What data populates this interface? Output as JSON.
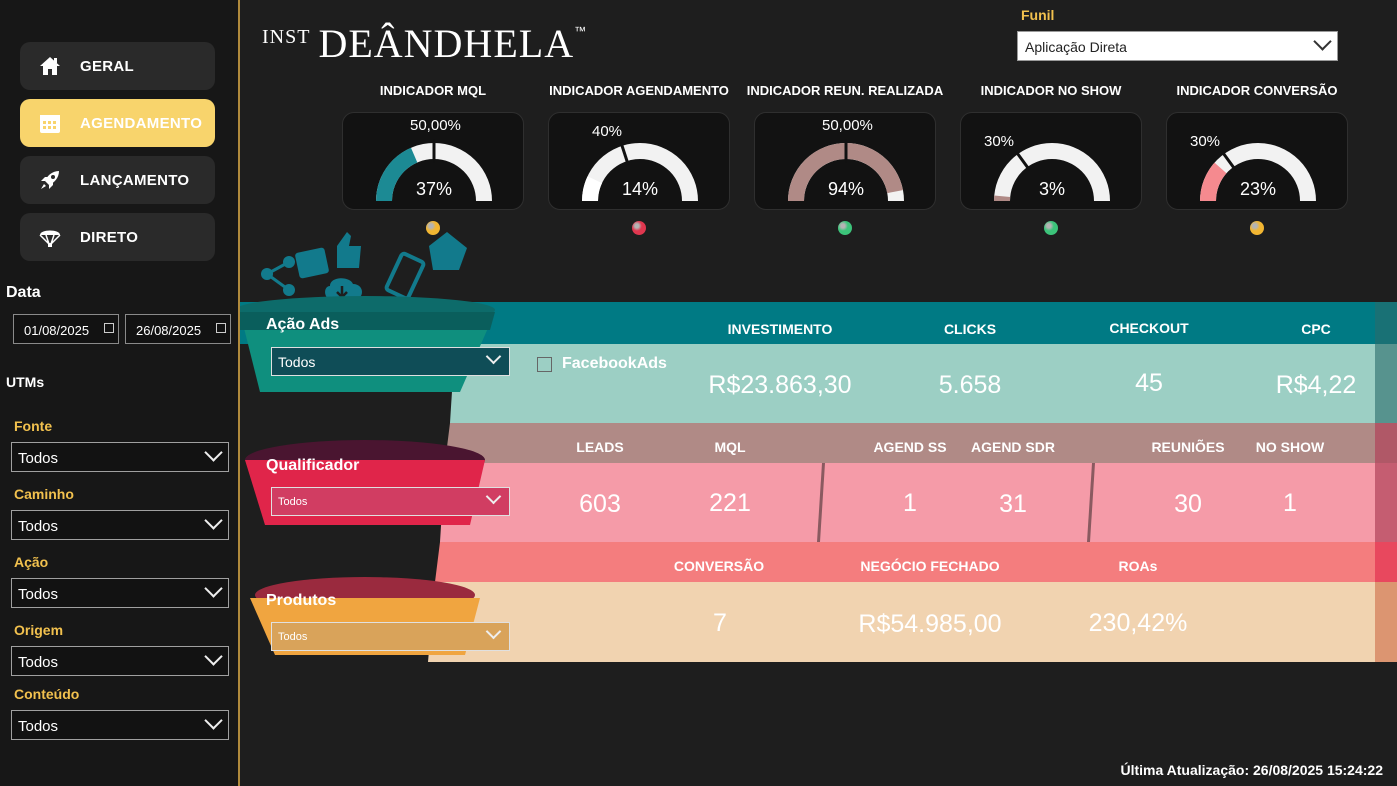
{
  "sidebar": {
    "nav": [
      {
        "label": "GERAL",
        "icon": "home-icon",
        "active": false
      },
      {
        "label": "AGENDAMENTO",
        "icon": "calendar-icon",
        "active": true
      },
      {
        "label": "LANÇAMENTO",
        "icon": "rocket-icon",
        "active": false
      },
      {
        "label": "DIRETO",
        "icon": "parachute-icon",
        "active": false
      }
    ],
    "date_label": "Data",
    "date_start": "01/08/2025",
    "date_end": "26/08/2025",
    "utms_label": "UTMs",
    "filters": [
      {
        "label": "Fonte",
        "value": "Todos"
      },
      {
        "label": "Caminho",
        "value": "Todos"
      },
      {
        "label": "Ação",
        "value": "Todos"
      },
      {
        "label": "Origem",
        "value": "Todos"
      },
      {
        "label": "Conteúdo",
        "value": "Todos"
      }
    ]
  },
  "header": {
    "logo_prefix": "INST",
    "logo_name": "DEÂNDHELA",
    "logo_tm": "™",
    "funil_label": "Funil",
    "funil_value": "Aplicação Direta"
  },
  "gauges": [
    {
      "title": "INDICADOR MQL",
      "value_label": "37%",
      "target_label": "50,00%",
      "value": 0.37,
      "target": 0.5,
      "color": "#1c8a94",
      "status_color": "#f2b632"
    },
    {
      "title": "INDICADOR AGENDAMENTO",
      "value_label": "14%",
      "target_label": "40%",
      "value": 0.14,
      "target": 0.4,
      "color": "#ffffff",
      "status_color": "#e0374f"
    },
    {
      "title": "INDICADOR REUN. REALIZADA",
      "value_label": "94%",
      "target_label": "50,00%",
      "value": 0.94,
      "target": 0.5,
      "color": "#b08a86",
      "status_color": "#3cc47a"
    },
    {
      "title": "INDICADOR NO SHOW",
      "value_label": "3%",
      "target_label": "30%",
      "value": 0.03,
      "target": 0.3,
      "color": "#b08a86",
      "status_color": "#3cc47a"
    },
    {
      "title": "INDICADOR CONVERSÃO",
      "value_label": "23%",
      "target_label": "30%",
      "value": 0.23,
      "target": 0.3,
      "color": "#f58a8f",
      "status_color": "#f2b632"
    }
  ],
  "funnel": {
    "acao_ads": {
      "label": "Ação Ads",
      "value": "Todos"
    },
    "facebook_label": "FacebookAds",
    "ads_headers": [
      "INVESTIMENTO",
      "CLICKS",
      "CHECKOUT",
      "CPC"
    ],
    "ads_values": [
      "R$23.863,30",
      "5.658",
      "45",
      "R$4,22"
    ],
    "qualificador": {
      "label": "Qualificador",
      "value": "Todos"
    },
    "qual_headers": [
      "LEADS",
      "MQL",
      "AGEND SS",
      "AGEND SDR",
      "REUNIÕES",
      "NO SHOW"
    ],
    "qual_values": [
      "603",
      "221",
      "1",
      "31",
      "30",
      "1"
    ],
    "produtos": {
      "label": "Produtos",
      "value": "Todos"
    },
    "prod_headers": [
      "CONVERSÃO",
      "NEGÓCIO FECHADO",
      "ROAs"
    ],
    "prod_values": [
      "7",
      "R$54.985,00",
      "230,42%"
    ]
  },
  "footer": "Última Atualização: 26/08/2025 15:24:22",
  "colors": {
    "teal_header": "#007a84",
    "teal_body": "#9ccfc4",
    "rose_header": "#b08a86",
    "pink_body": "#f59ba8",
    "coral_header": "#f47d7e",
    "peach_body": "#f1d3b0",
    "accent_gold": "#f2c14e"
  }
}
